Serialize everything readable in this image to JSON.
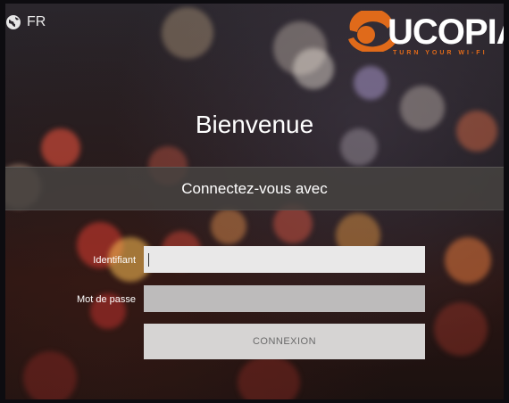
{
  "header": {
    "language": "FR",
    "language_icon": "globe-icon",
    "brand": {
      "name": "UCOPIA",
      "tagline": "TURN YOUR WI-FI"
    }
  },
  "login": {
    "welcome": "Bienvenue",
    "connect_prompt": "Connectez-vous avec",
    "username_label": "Identifiant",
    "username_value": "",
    "password_label": "Mot de passe",
    "password_value": "",
    "submit_label": "CONNEXION"
  },
  "colors": {
    "brand_orange": "#e06a1a",
    "band_background": "#46423f",
    "input_light": "#e9e8e8",
    "input_dark": "#bdbbbb",
    "button": "#d6d4d3"
  }
}
